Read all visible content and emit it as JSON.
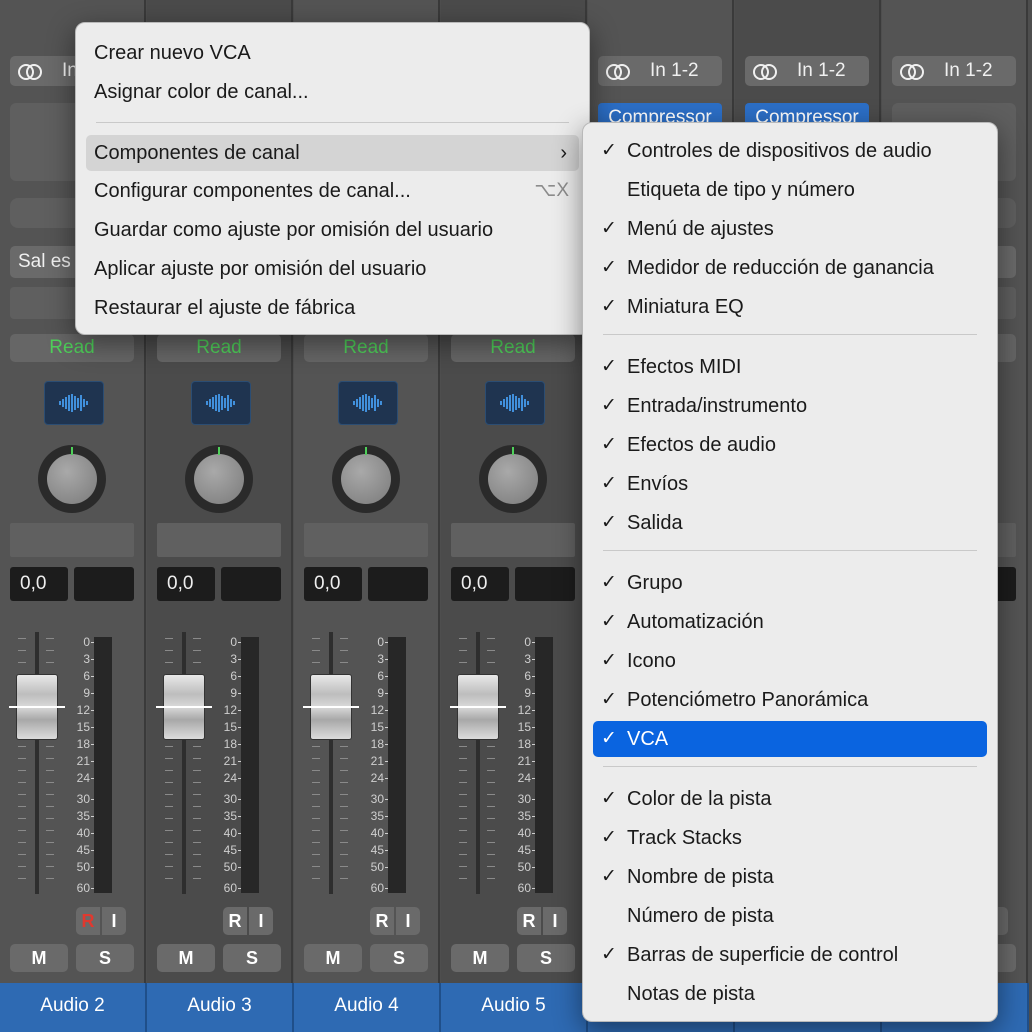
{
  "strips": [
    {
      "input": "In",
      "output": "Sal es",
      "read": "Read",
      "volume": "0,0",
      "name": "Audio 2",
      "r_red": true,
      "comp": null
    },
    {
      "input": "",
      "output": "",
      "read": "Read",
      "volume": "0,0",
      "name": "Audio 3",
      "r_red": false,
      "comp": null
    },
    {
      "input": "",
      "output": "",
      "read": "Read",
      "volume": "0,0",
      "name": "Audio 4",
      "r_red": false,
      "comp": null
    },
    {
      "input": "",
      "output": "",
      "read": "Read",
      "volume": "0,0",
      "name": "Audio 5",
      "r_red": false,
      "comp": null
    },
    {
      "input": "In 1-2",
      "output": "",
      "read": "",
      "volume": "",
      "name": "",
      "r_red": false,
      "comp": "Compressor"
    },
    {
      "input": "In 1-2",
      "output": "",
      "read": "",
      "volume": "",
      "name": "",
      "r_red": false,
      "comp": "Compressor"
    },
    {
      "input": "In 1-2",
      "output": "",
      "read": "",
      "volume": "",
      "name": "",
      "r_red": false,
      "comp": null
    }
  ],
  "buttons": {
    "r": "R",
    "i": "I",
    "m": "M",
    "s": "S"
  },
  "scale_marks": [
    "0",
    "3",
    "6",
    "9",
    "12",
    "15",
    "18",
    "21",
    "24",
    "30",
    "35",
    "40",
    "45",
    "50",
    "60"
  ],
  "context_menu": {
    "items": [
      {
        "label": "Crear nuevo VCA"
      },
      {
        "label": "Asignar color de canal..."
      },
      {
        "label": "Componentes de canal",
        "submenu": true,
        "highlighted": true
      },
      {
        "label": "Configurar componentes de canal...",
        "shortcut": "⌥X"
      },
      {
        "label": "Guardar como ajuste por omisión del usuario"
      },
      {
        "label": "Aplicar ajuste por omisión del usuario"
      },
      {
        "label": "Restaurar el ajuste de fábrica"
      }
    ],
    "submenu_arrow": "›"
  },
  "submenu": {
    "check_glyph": "✓",
    "groups": [
      [
        {
          "label": "Controles de dispositivos de audio",
          "checked": true
        },
        {
          "label": "Etiqueta de tipo y número",
          "checked": false
        },
        {
          "label": "Menú de ajustes",
          "checked": true
        },
        {
          "label": "Medidor de reducción de ganancia",
          "checked": true
        },
        {
          "label": "Miniatura EQ",
          "checked": true
        }
      ],
      [
        {
          "label": "Efectos MIDI",
          "checked": true
        },
        {
          "label": "Entrada/instrumento",
          "checked": true
        },
        {
          "label": "Efectos de audio",
          "checked": true
        },
        {
          "label": "Envíos",
          "checked": true
        },
        {
          "label": "Salida",
          "checked": true
        }
      ],
      [
        {
          "label": "Grupo",
          "checked": true
        },
        {
          "label": "Automatización",
          "checked": true
        },
        {
          "label": "Icono",
          "checked": true
        },
        {
          "label": "Potenciómetro Panorámica",
          "checked": true
        },
        {
          "label": "VCA",
          "checked": true,
          "selected": true
        }
      ],
      [
        {
          "label": "Color de la pista",
          "checked": true
        },
        {
          "label": "Track Stacks",
          "checked": true
        },
        {
          "label": "Nombre de pista",
          "checked": true
        },
        {
          "label": "Número de pista",
          "checked": false
        },
        {
          "label": "Barras de superficie de control",
          "checked": true
        },
        {
          "label": "Notas de pista",
          "checked": false
        }
      ]
    ]
  },
  "colors": {
    "read_text": "#4fd05a",
    "name_bar": "#2e6ab3",
    "selection": "#0a64e0",
    "compressor": "#2c6fc7"
  }
}
